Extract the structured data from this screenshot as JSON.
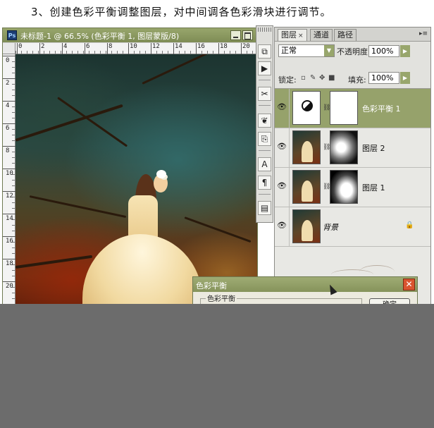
{
  "caption": "3、创建色彩平衡调整图层，对中间调各色彩滑块进行调节。",
  "document": {
    "title": "未标题-1 @ 66.5% (色彩平衡 1, 图层蒙版/8)",
    "ruler_h_ticks": [
      "0",
      "2",
      "4",
      "6",
      "8",
      "10",
      "12",
      "14",
      "16",
      "18",
      "20"
    ],
    "ruler_v_ticks": [
      "0",
      "2",
      "4",
      "6",
      "8",
      "10",
      "12",
      "14",
      "16",
      "18",
      "20"
    ]
  },
  "toolstrip": {
    "icons": [
      "history-icon",
      "actions-play-icon",
      "tools-presets-icon",
      "brushes-icon",
      "clone-source-icon",
      "character-text-icon",
      "paragraph-icon",
      "layer-comps-icon"
    ],
    "glyphs": [
      "⧉",
      "▶",
      "✂",
      "❦",
      "⎘",
      "A",
      "¶",
      "▤"
    ]
  },
  "layers_panel": {
    "tabs": [
      {
        "label": "图层",
        "close": "×",
        "active": true
      },
      {
        "label": "通道",
        "active": false
      },
      {
        "label": "路径",
        "active": false
      }
    ],
    "menu_glyph": "▸≡",
    "blend_mode": "正常",
    "opacity_label": "不透明度:",
    "opacity_value": "100%",
    "lock_label": "锁定:",
    "fill_label": "填充:",
    "fill_value": "100%",
    "layers": [
      {
        "name": "色彩平衡 1",
        "selected": true,
        "type": "adjustment",
        "visible": true
      },
      {
        "name": "图层 2",
        "selected": false,
        "type": "image-mask",
        "visible": true
      },
      {
        "name": "图层 1",
        "selected": false,
        "type": "image-mask",
        "visible": true
      },
      {
        "name": "背景",
        "selected": false,
        "type": "background",
        "locked": true,
        "visible": true
      }
    ]
  },
  "dialog": {
    "title": "色彩平衡",
    "group_label": "色彩平衡",
    "ok_label": "确定",
    "close_glyph": "✕"
  },
  "colors": {
    "title_bar": "#98a66c",
    "selected_layer": "#96a26b",
    "dialog_close": "#d9542f",
    "bottom_fill": "#6c6c6c"
  }
}
